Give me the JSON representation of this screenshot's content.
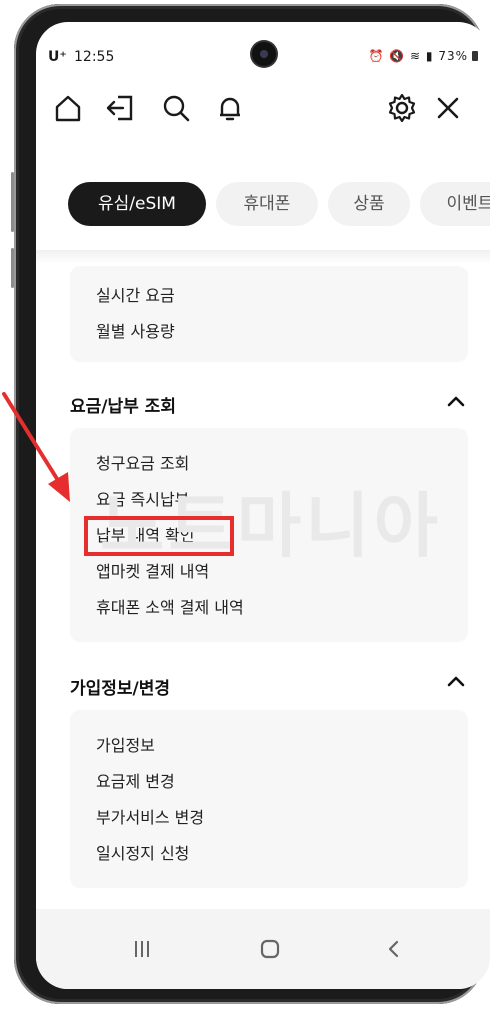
{
  "status_bar": {
    "carrier": "U⁺",
    "time": "12:55",
    "battery": "73%"
  },
  "nav": {
    "icons": [
      "home-icon",
      "logout-icon",
      "search-icon",
      "bell-icon",
      "gear-icon",
      "close-icon"
    ]
  },
  "tabs": [
    {
      "label": "유심/eSIM",
      "active": true
    },
    {
      "label": "휴대폰",
      "active": false
    },
    {
      "label": "상품",
      "active": false
    },
    {
      "label": "이벤트",
      "active": false
    }
  ],
  "top_card": {
    "items": [
      "실시간 요금",
      "월별 사용량"
    ]
  },
  "billing_section": {
    "title": "요금/납부 조회",
    "items": [
      "청구요금 조회",
      "요금 즉시납부",
      "납부 내역 확인",
      "앱마켓 결제 내역",
      "휴대폰 소액 결제 내역"
    ]
  },
  "subscription_section": {
    "title": "가입정보/변경",
    "items": [
      "가입정보",
      "요금제 변경",
      "부가서비스 변경",
      "일시정지 신청"
    ]
  },
  "watermark": "노트마니아",
  "accent": {
    "highlight": "#e62e2e",
    "dark": "#1a1a1a"
  }
}
